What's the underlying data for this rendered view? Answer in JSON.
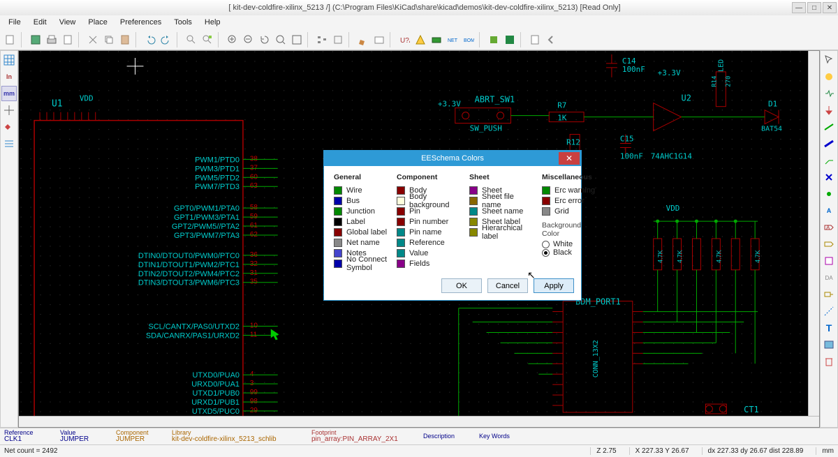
{
  "window": {
    "title": "[ kit-dev-coldfire-xilinx_5213 /] (C:\\Program Files\\KiCad\\share\\kicad\\demos\\kit-dev-coldfire-xilinx_5213) [Read Only]",
    "minimize": "—",
    "maximize": "□",
    "close": "✕"
  },
  "menu": [
    "File",
    "Edit",
    "View",
    "Place",
    "Preferences",
    "Tools",
    "Help"
  ],
  "left_tools": [
    "grid",
    "In",
    "mm",
    "cur",
    "arr",
    "box"
  ],
  "right_tools": [
    "sel",
    "pwr",
    "lbl",
    "glbl",
    "bus",
    "junc",
    "noconn",
    "wire",
    "net",
    "hier",
    "txt",
    "line",
    "arc",
    "del",
    "DA",
    "txtT",
    "img"
  ],
  "dialog": {
    "title": "EESchema Colors",
    "columns": {
      "general": {
        "header": "General",
        "items": [
          {
            "label": "Wire",
            "color": "#008800"
          },
          {
            "label": "Bus",
            "color": "#0000aa"
          },
          {
            "label": "Junction",
            "color": "#008800"
          },
          {
            "label": "Label",
            "color": "#000000"
          },
          {
            "label": "Global label",
            "color": "#880000"
          },
          {
            "label": "Net name",
            "color": "#888888"
          },
          {
            "label": "Notes",
            "color": "#4444cc"
          },
          {
            "label": "No Connect Symbol",
            "color": "#0000aa"
          }
        ]
      },
      "component": {
        "header": "Component",
        "items": [
          {
            "label": "Body",
            "color": "#880000"
          },
          {
            "label": "Body background",
            "color": "#ffffdd"
          },
          {
            "label": "Pin",
            "color": "#880000"
          },
          {
            "label": "Pin number",
            "color": "#880000"
          },
          {
            "label": "Pin name",
            "color": "#008888"
          },
          {
            "label": "Reference",
            "color": "#008888"
          },
          {
            "label": "Value",
            "color": "#008888"
          },
          {
            "label": "Fields",
            "color": "#880088"
          }
        ]
      },
      "sheet": {
        "header": "Sheet",
        "items": [
          {
            "label": "Sheet",
            "color": "#880088"
          },
          {
            "label": "Sheet file name",
            "color": "#886600"
          },
          {
            "label": "Sheet name",
            "color": "#008888"
          },
          {
            "label": "Sheet label",
            "color": "#888800"
          },
          {
            "label": "Hierarchical label",
            "color": "#888800"
          }
        ]
      },
      "misc": {
        "header": "Miscellaneous",
        "items": [
          {
            "label": "Erc warning",
            "color": "#008800"
          },
          {
            "label": "Erc error",
            "color": "#880000"
          },
          {
            "label": "Grid",
            "color": "#888888"
          }
        ],
        "bg_label": "Background Color",
        "radios": [
          {
            "label": "White",
            "checked": false
          },
          {
            "label": "Black",
            "checked": true
          }
        ]
      }
    },
    "buttons": {
      "ok": "OK",
      "cancel": "Cancel",
      "apply": "Apply"
    }
  },
  "info": {
    "reference": {
      "h": "Reference",
      "v": "CLK1"
    },
    "value": {
      "h": "Value",
      "v": "JUMPER"
    },
    "component": {
      "h": "Component",
      "v": "JUMPER"
    },
    "library": {
      "h": "Library",
      "v": "kit-dev-coldfire-xilinx_5213_schlib"
    },
    "footprint": {
      "h": "Footprint",
      "v": "pin_array:PIN_ARRAY_2X1"
    },
    "description": {
      "h": "Description",
      "v": ""
    },
    "keywords": {
      "h": "Key Words",
      "v": ""
    }
  },
  "status": {
    "left": "Net count = 2492",
    "z": "Z 2.75",
    "xy": "X 227.33  Y 26.67",
    "dxy": "dx 227.33  dy 26.67  dist 228.89",
    "unit": "mm"
  },
  "schematic_labels": {
    "u1": "U1",
    "vdd": "VDD",
    "p33v": "+3.3V",
    "abrt": "ABRT_SW1",
    "swpush": "SW_PUSH",
    "r7": "R7",
    "r7v": "1K",
    "r12": "R12",
    "c14": "C14",
    "c14v": "100nF",
    "c15": "C15",
    "c15v": "100nF",
    "p33v2": "+3.3V",
    "u2": "U2",
    "r14": "R14",
    "r14v": "270",
    "ahc": "74AHC1G14",
    "d1": "D1",
    "bat": "BAT54",
    "bdm": "BDM_PORT1",
    "conn": "CONN_13X2",
    "ct1": "CT1",
    "led": "LED",
    "vdd2": "VDD",
    "r17": "4.7K",
    "r18": "4.7K",
    "r19": "4.7K",
    "r20": "4.7K",
    "pins": [
      "PWM1/PTD0",
      "PWM3/PTD1",
      "PWM5/PTD2",
      "PWM7/PTD3",
      "GPT0/PWM1/PTA0",
      "GPT1/PWM3/PTA1",
      "GPT2/PWM5//PTA2",
      "GPT3/PWM7/PTA3",
      "DTIN0/DTOUT0/PWM0/PTC0",
      "DTIN1/DTOUT1/PWM2/PTC1",
      "DTIN2/DTOUT2/PWM4/PTC2",
      "DTIN3/DTOUT3/PWM6/PTC3",
      "SCL/CANTX/PAS0/UTXD2",
      "SDA/CANRX/PAS1/URXD2",
      "UTXD0/PUA0",
      "URXD0/PUA1",
      "UTXD1/PUB0",
      "URXD1/PUB1",
      "UTXD5/PUC0"
    ],
    "pin_nums": [
      "38",
      "37",
      "60",
      "63",
      "58",
      "59",
      "61",
      "62",
      "36",
      "32",
      "31",
      "35",
      "10",
      "11",
      "4",
      "3",
      "99",
      "98",
      "29"
    ]
  }
}
